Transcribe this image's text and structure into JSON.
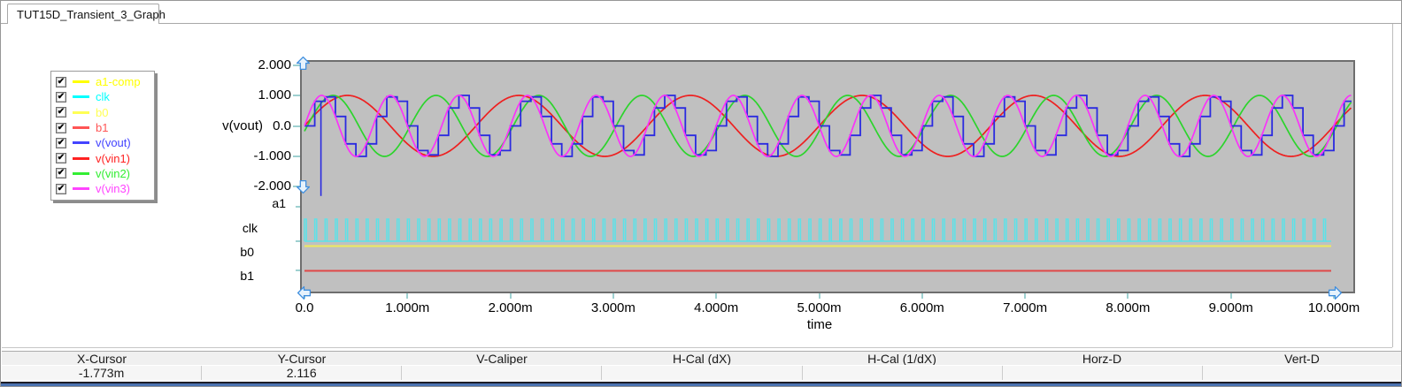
{
  "tab": {
    "title": "TUT15D_Transient_3_Graph"
  },
  "legend": {
    "items": [
      {
        "label": "a1-comp",
        "color": "#ffff00",
        "checked": true
      },
      {
        "label": "clk",
        "color": "#00ffff",
        "checked": true
      },
      {
        "label": "b0",
        "color": "#ffff55",
        "checked": true
      },
      {
        "label": "b1",
        "color": "#ff5555",
        "checked": true
      },
      {
        "label": "v(vout)",
        "color": "#4444ff",
        "checked": true
      },
      {
        "label": "v(vin1)",
        "color": "#ff2222",
        "checked": true
      },
      {
        "label": "v(vin2)",
        "color": "#33ee33",
        "checked": true
      },
      {
        "label": "v(vin3)",
        "color": "#ff44ff",
        "checked": true
      }
    ],
    "check_glyph": "✔"
  },
  "chart_data": {
    "type": "line",
    "title": "",
    "x_axis": {
      "label": "time",
      "min_s": 0,
      "max_s": 0.01,
      "tick_labels": [
        "0.0",
        "1.000m",
        "2.000m",
        "3.000m",
        "4.000m",
        "5.000m",
        "6.000m",
        "7.000m",
        "8.000m",
        "9.000m",
        "10.000m"
      ]
    },
    "y_axis": {
      "label": "v(vout)",
      "min": -2.0,
      "max": 2.0,
      "tick_labels": [
        "2.000",
        "1.000",
        "0.0",
        "-1.000",
        "-2.000"
      ],
      "tick_values": [
        2.0,
        1.0,
        0.0,
        -1.0,
        -2.0
      ]
    },
    "series": [
      {
        "name": "v(vin1)",
        "color": "#ee2020",
        "kind": "sine",
        "amplitude": 1.0,
        "frequency_hz": 600,
        "phase_deg": 0
      },
      {
        "name": "v(vin2)",
        "color": "#2cd42c",
        "kind": "sine",
        "amplitude": 1.0,
        "frequency_hz": 1000,
        "phase_deg": -10
      },
      {
        "name": "v(vin3)",
        "color": "#fa32fa",
        "kind": "sine",
        "amplitude": 1.0,
        "frequency_hz": 1500,
        "phase_deg": 0
      },
      {
        "name": "v(vout)",
        "color": "#2a2ae0",
        "kind": "staircase",
        "source": "v(vin3)",
        "sample_rate_hz": 10000,
        "startup_glitch": {
          "time_s": 0.00016,
          "value": -2.3
        }
      }
    ],
    "digital_rows": [
      {
        "name": "a1",
        "style": "empty",
        "color": ""
      },
      {
        "name": "clk",
        "style": "pulse_train",
        "color": "#5ce2e8",
        "frequency_hz": 10000
      },
      {
        "name": "b0",
        "style": "flat",
        "color": "#eeea5e"
      },
      {
        "name": "b1",
        "style": "flat",
        "color": "#e04848"
      }
    ]
  },
  "cursor_bar": {
    "columns": [
      {
        "header": "X-Cursor",
        "value": "-1.773m"
      },
      {
        "header": "Y-Cursor",
        "value": "2.116"
      },
      {
        "header": "V-Caliper",
        "value": ""
      },
      {
        "header": "H-Cal (dX)",
        "value": ""
      },
      {
        "header": "H-Cal (1/dX)",
        "value": ""
      },
      {
        "header": "Horz-D",
        "value": ""
      },
      {
        "header": "Vert-D",
        "value": ""
      }
    ]
  }
}
